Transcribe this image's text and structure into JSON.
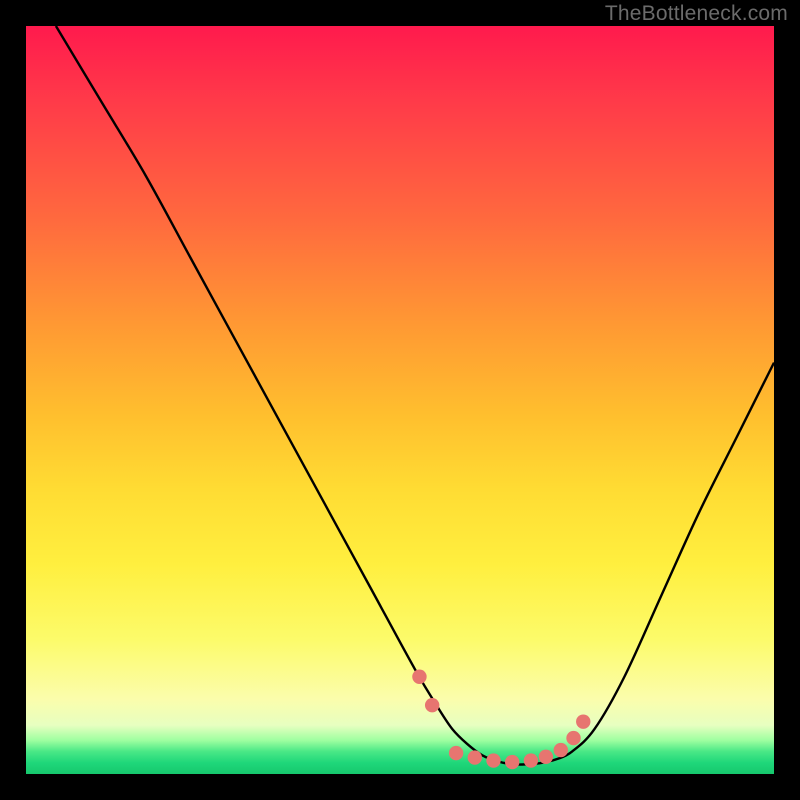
{
  "watermark": "TheBottleneck.com",
  "colors": {
    "frame": "#000000",
    "curve": "#000000",
    "markers": "#e77570"
  },
  "chart_data": {
    "type": "line",
    "title": "",
    "xlabel": "",
    "ylabel": "",
    "xlim": [
      0,
      100
    ],
    "ylim": [
      0,
      100
    ],
    "grid": false,
    "legend": false,
    "series": [
      {
        "name": "bottleneck-curve",
        "x": [
          4,
          10,
          16,
          22,
          28,
          34,
          40,
          46,
          52,
          55,
          57,
          59,
          61,
          63,
          65,
          67,
          69,
          71,
          73,
          76,
          80,
          85,
          90,
          95,
          100
        ],
        "y": [
          100,
          90,
          80,
          69,
          58,
          47,
          36,
          25,
          14,
          9,
          6,
          4,
          2.5,
          1.7,
          1.3,
          1.3,
          1.5,
          2,
          3,
          6,
          13,
          24,
          35,
          45,
          55
        ]
      }
    ],
    "markers": {
      "name": "highlight-dots",
      "x": [
        52.6,
        54.3,
        57.5,
        60.0,
        62.5,
        65.0,
        67.5,
        69.5,
        71.5,
        73.2,
        74.5
      ],
      "y": [
        13.0,
        9.2,
        2.8,
        2.2,
        1.8,
        1.6,
        1.8,
        2.3,
        3.2,
        4.8,
        7.0
      ]
    }
  }
}
